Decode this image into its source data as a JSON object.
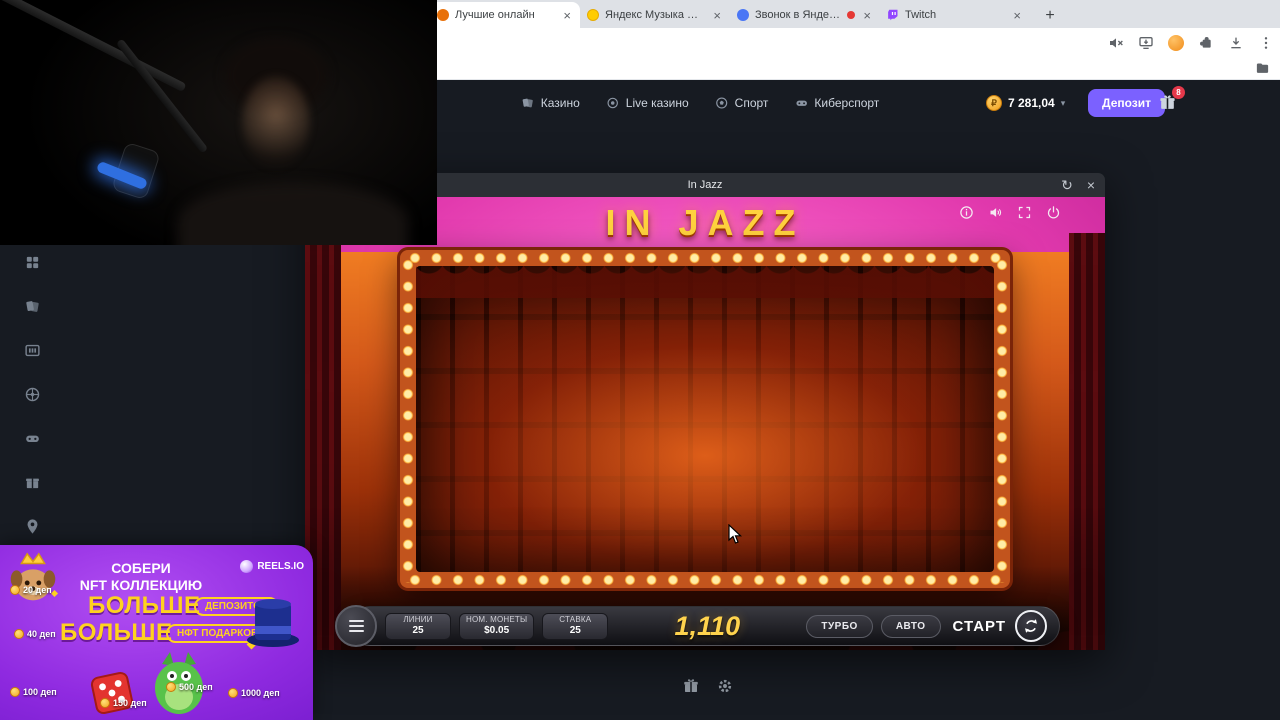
{
  "browser": {
    "tab_close_glyph": "×",
    "new_tab_glyph": "+",
    "tabs": [
      {
        "label": "Лучшие онлайн"
      },
      {
        "label": "Яндекс Музыка — собираем"
      },
      {
        "label": "Звонок в Яндекс Телемост"
      },
      {
        "label": "Twitch"
      }
    ]
  },
  "casino": {
    "nav": [
      {
        "label": "Казино"
      },
      {
        "label": "Live казино"
      },
      {
        "label": "Спорт"
      },
      {
        "label": "Киберспорт"
      }
    ],
    "currency_symbol": "₽",
    "balance": "7 281,04",
    "balance_caret": "▾",
    "deposit_label": "Депозит",
    "gift_badge_count": "8"
  },
  "modal": {
    "title": "In Jazz",
    "refresh_glyph": "↻",
    "close_glyph": "×"
  },
  "game": {
    "logo": "IN JAZZ",
    "controls": {
      "lines_label": "ЛИНИИ",
      "lines_value": "25",
      "coin_label": "НОМ. МОНЕТЫ",
      "coin_value": "$0.05",
      "bet_label": "СТАВКА",
      "bet_value": "25",
      "amount_display": "1,110",
      "turbo_label": "ТУРБО",
      "auto_label": "АВТО",
      "start_label": "СТАРТ"
    }
  },
  "promo": {
    "headline_line1": "СОБЕРИ",
    "headline_line2": "NFT КОЛЛЕКЦИЮ",
    "brand": "REELS.IO",
    "big1": "БОЛЬШЕ",
    "pill1": "ДЕПОЗИТОВ",
    "big2": "БОЛЬШЕ",
    "pill2": "НФТ ПОДАРКОВ!",
    "badges": [
      "20 деп",
      "40 деп",
      "100 деп",
      "150 деп",
      "500 деп",
      "1000 деп"
    ]
  },
  "colors": {
    "accent_purple": "#7b61ff",
    "gold": "#ffd21f",
    "stage_orange": "#c2541d",
    "magenta": "#e23aae",
    "promo_purple": "#8f2ae0",
    "twitch_purple": "#9146ff",
    "record_red": "#e53935"
  }
}
